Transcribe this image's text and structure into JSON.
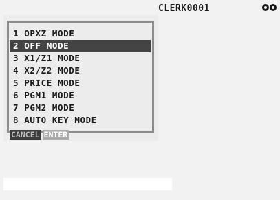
{
  "header": {
    "clerk": "CLERK0001",
    "status_icon": "connection-icon"
  },
  "menu": {
    "items": [
      {
        "label": "1 OPXZ MODE"
      },
      {
        "label": "2 OFF MODE"
      },
      {
        "label": "3 X1/Z1 MODE"
      },
      {
        "label": "4 X2/Z2 MODE"
      },
      {
        "label": "5 PRICE MODE"
      },
      {
        "label": "6 PGM1 MODE"
      },
      {
        "label": "7 PGM2 MODE"
      },
      {
        "label": "8 AUTO KEY MODE"
      }
    ],
    "selected_index": 1
  },
  "softkeys": {
    "cancel": "CANCEL",
    "enter": "ENTER"
  },
  "input": {
    "value": ""
  }
}
